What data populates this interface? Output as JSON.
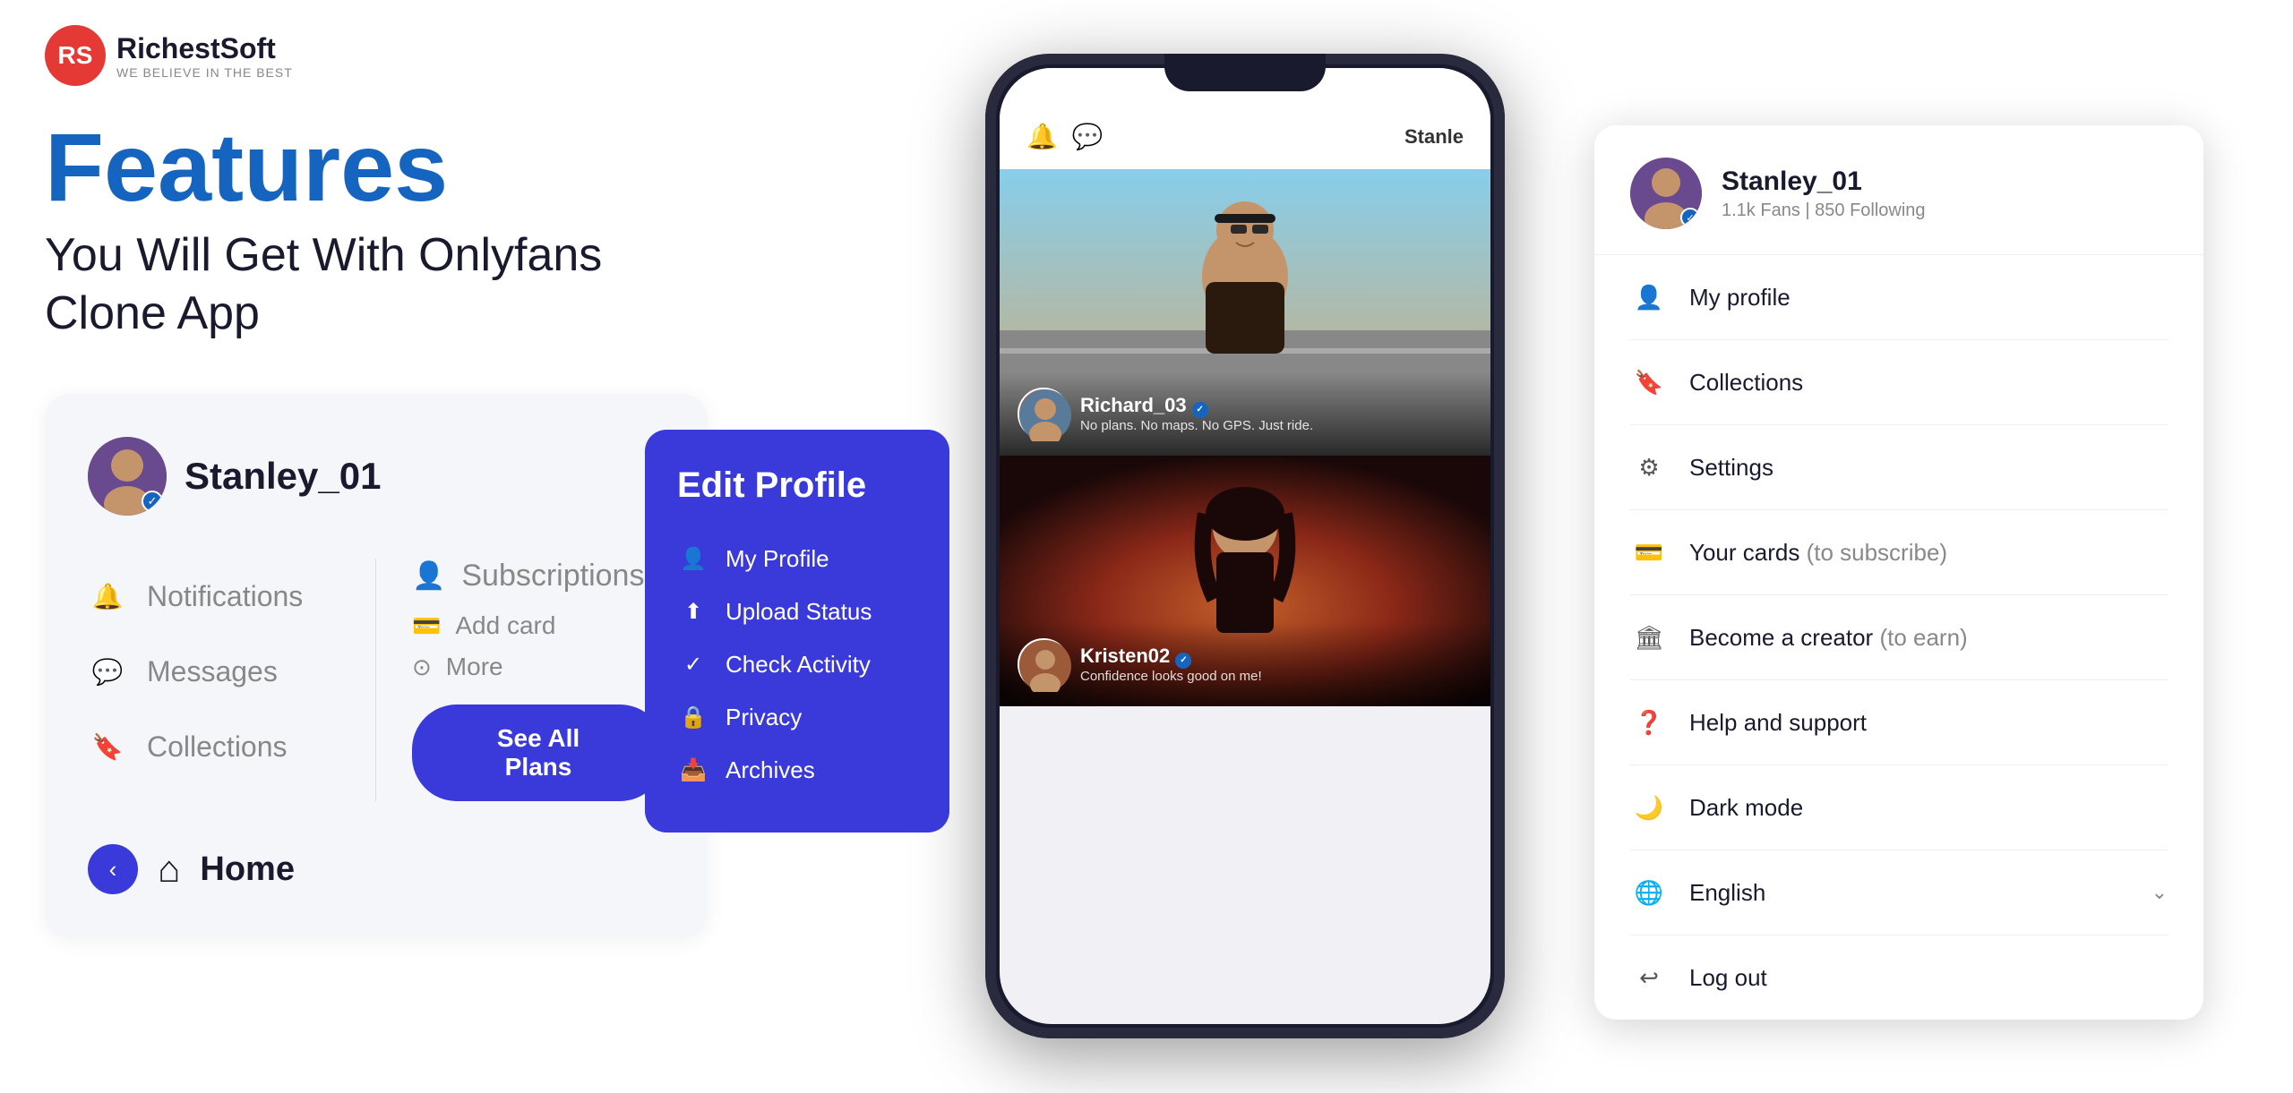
{
  "logo": {
    "brand": "RichestSoft",
    "tagline": "WE BELIEVE IN THE BEST",
    "initials": "RS"
  },
  "hero": {
    "title": "Features",
    "subtitle_line1": "You Will Get With Onlyfans",
    "subtitle_line2": "Clone App"
  },
  "left_panel": {
    "username": "Stanley_01",
    "menu_items": [
      {
        "label": "Notifications",
        "icon": "🔔"
      },
      {
        "label": "Messages",
        "icon": "💬"
      },
      {
        "label": "Collections",
        "icon": "🔖"
      }
    ],
    "subscriptions_label": "Subscriptions",
    "sub_items": [
      {
        "label": "Add card",
        "icon": "💳"
      },
      {
        "label": "More",
        "icon": "⊙"
      }
    ],
    "see_all_btn": "See All Plans",
    "home_label": "Home"
  },
  "edit_profile": {
    "title": "Edit Profile",
    "items": [
      {
        "label": "My Profile",
        "icon": "👤"
      },
      {
        "label": "Upload Status",
        "icon": "⬆"
      },
      {
        "label": "Check Activity",
        "icon": "✓"
      },
      {
        "label": "Privacy",
        "icon": "🔒"
      },
      {
        "label": "Archives",
        "icon": "📥"
      }
    ]
  },
  "phone": {
    "user_tag": "Stanle",
    "post1": {
      "username": "Richard_03",
      "verified": true,
      "caption": "No plans. No maps. No GPS. Just ride."
    },
    "post2": {
      "username": "Kristen02",
      "verified": true,
      "caption": "Confidence looks good on me!"
    }
  },
  "dropdown": {
    "username": "Stanley_01",
    "fans": "1.1k Fans",
    "following": "850 Following",
    "items": [
      {
        "label": "My profile",
        "icon": "👤",
        "muted": ""
      },
      {
        "label": "Collections",
        "icon": "🔖",
        "muted": ""
      },
      {
        "label": "Settings",
        "icon": "⚙",
        "muted": ""
      },
      {
        "label": "Your cards",
        "icon": "💳",
        "muted": "(to subscribe)"
      },
      {
        "label": "Become a creator",
        "icon": "🏛",
        "muted": "(to earn)"
      },
      {
        "label": "Help and support",
        "icon": "❓",
        "muted": ""
      },
      {
        "label": "Dark mode",
        "icon": "🌙",
        "muted": ""
      },
      {
        "label": "English",
        "icon": "🌐",
        "muted": "",
        "chevron": true
      },
      {
        "label": "Log out",
        "icon": "↩",
        "muted": ""
      }
    ]
  }
}
